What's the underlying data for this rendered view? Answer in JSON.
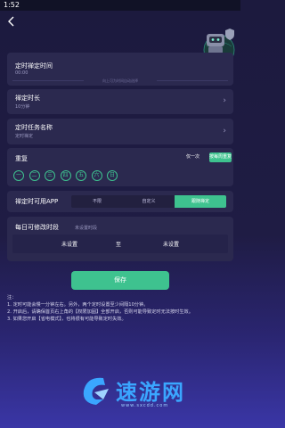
{
  "status_bar": {
    "time": "1:52"
  },
  "header": {
    "back_icon": "back-arrow-icon"
  },
  "schedule_time": {
    "title": "定时禅定时间",
    "value": "00:00",
    "hint": "向上可为时间自动选择"
  },
  "duration": {
    "title": "禅定时长",
    "value": "10分钟"
  },
  "task_name": {
    "title": "定时任务名称",
    "value": "定时禅定"
  },
  "repeat": {
    "title": "重复",
    "options": [
      "仅一次",
      "按每周重复"
    ],
    "selected": "按每周重复",
    "days": [
      "一",
      "二",
      "三",
      "四",
      "五",
      "六",
      "日"
    ],
    "accent": "#3ec28f"
  },
  "apps": {
    "title": "禅定时可用APP",
    "options": [
      "不限",
      "自定义",
      "跟随禅定"
    ],
    "selected": "跟随禅定"
  },
  "daily_edit": {
    "title": "每日可修改时段",
    "hint": "未设置时段",
    "start": "未设置",
    "to": "至",
    "end": "未设置"
  },
  "save_label": "保存",
  "notes": [
    "注：",
    "1. 定时可能会慢一分钟左右。另外，两个定时设置至少间隔10分钟。",
    "2. 开启后，请确保首页右上角的【权限加固】全部开启，否则可能导致定时无法按时生效。",
    "3. 如果您开启【省电模式】，也将很有可能导致定时失效。"
  ],
  "watermark": {
    "text": "速游网",
    "url": "www.sxcdd.com"
  }
}
